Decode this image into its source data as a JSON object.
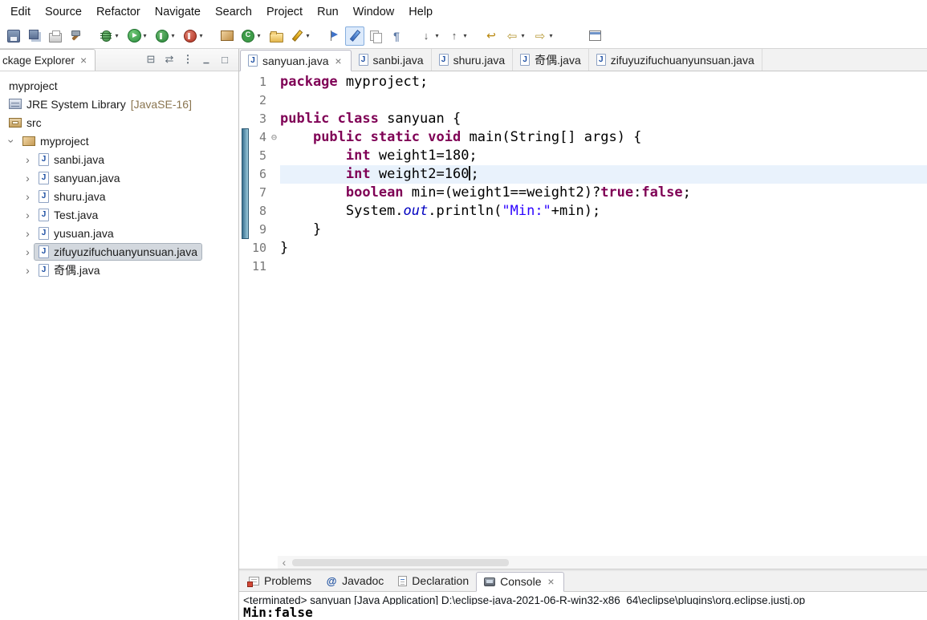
{
  "menu_bar": {
    "items": [
      "Edit",
      "Source",
      "Refactor",
      "Navigate",
      "Search",
      "Project",
      "Run",
      "Window",
      "Help"
    ]
  },
  "toolbar": {
    "icons": [
      {
        "name": "save-icon",
        "kind": "save"
      },
      {
        "name": "save-all-icon",
        "kind": "saveall"
      },
      {
        "name": "print-icon",
        "kind": "print"
      },
      {
        "name": "build-all-icon",
        "kind": "build"
      },
      {
        "name": "debug-icon",
        "kind": "debug",
        "dropdown": true,
        "group_start": true
      },
      {
        "name": "run-icon",
        "kind": "run",
        "dropdown": true
      },
      {
        "name": "coverage-icon",
        "kind": "coverage",
        "dropdown": true
      },
      {
        "name": "profile-icon",
        "kind": "profile",
        "dropdown": true
      },
      {
        "name": "new-java-project-icon",
        "kind": "package",
        "group_start": true
      },
      {
        "name": "new-class-icon",
        "kind": "class",
        "dropdown": true
      },
      {
        "name": "open-folder-icon",
        "kind": "folder"
      },
      {
        "name": "new-wizard-icon",
        "kind": "pencil",
        "dropdown": true
      },
      {
        "name": "search-icon",
        "kind": "flag",
        "group_start": true
      },
      {
        "name": "toggle-mark-occurrences-icon",
        "kind": "marker",
        "pressed": true
      },
      {
        "name": "compare-icon",
        "kind": "docs"
      },
      {
        "name": "show-whitespace-icon",
        "kind": "para"
      },
      {
        "name": "next-annotation-icon",
        "kind": "down",
        "dropdown": true,
        "group_start": true
      },
      {
        "name": "previous-annotation-icon",
        "kind": "up",
        "dropdown": true
      },
      {
        "name": "last-edit-location-icon",
        "kind": "lastedit",
        "group_start": true
      },
      {
        "name": "back-icon",
        "kind": "back",
        "dropdown": true
      },
      {
        "name": "forward-icon",
        "kind": "fwd",
        "dropdown": true
      },
      {
        "name": "restore-editor-icon",
        "kind": "window",
        "far": true
      }
    ]
  },
  "package_explorer": {
    "title": "ckage Explorer",
    "view_toolbar": [
      {
        "name": "collapse-all-icon",
        "kind": "collapse"
      },
      {
        "name": "link-with-editor-icon",
        "kind": "link"
      },
      {
        "name": "view-menu-icon",
        "kind": "menu"
      },
      {
        "name": "minimize-icon",
        "kind": "min"
      },
      {
        "name": "maximize-icon",
        "kind": "max"
      }
    ],
    "tree": [
      {
        "label": "myproject",
        "icon": "",
        "depth": 0
      },
      {
        "label": "JRE System Library",
        "suffix": " [JavaSE-16]",
        "icon": "library",
        "depth": 0
      },
      {
        "label": "src",
        "icon": "src-folder",
        "depth": 0
      },
      {
        "label": "myproject",
        "icon": "package",
        "depth": 0,
        "chevron": "expanded"
      },
      {
        "label": "sanbi.java",
        "icon": "java-file",
        "depth": 1,
        "chevron": "collapsed"
      },
      {
        "label": "sanyuan.java",
        "icon": "java-file",
        "depth": 1,
        "chevron": "collapsed"
      },
      {
        "label": "shuru.java",
        "icon": "java-file",
        "depth": 1,
        "chevron": "collapsed"
      },
      {
        "label": "Test.java",
        "icon": "java-file",
        "depth": 1,
        "chevron": "collapsed"
      },
      {
        "label": "yusuan.java",
        "icon": "java-file",
        "depth": 1,
        "chevron": "collapsed"
      },
      {
        "label": "zifuyuzifuchuanyunsuan.java",
        "icon": "java-file",
        "depth": 1,
        "chevron": "collapsed",
        "selected": true
      },
      {
        "label": "奇偶.java",
        "icon": "java-file",
        "depth": 1,
        "chevron": "collapsed"
      }
    ]
  },
  "editor": {
    "tabs": [
      {
        "label": "sanyuan.java",
        "active": true,
        "closable": true
      },
      {
        "label": "sanbi.java"
      },
      {
        "label": "shuru.java"
      },
      {
        "label": "奇偶.java"
      },
      {
        "label": "zifuyuzifuchuanyunsuan.java"
      }
    ],
    "code": {
      "range_indicator": {
        "from": 4,
        "to": 9
      },
      "lines": [
        {
          "num": 1,
          "tokens": [
            [
              "kw",
              "package"
            ],
            [
              "pl",
              " myproject;"
            ]
          ]
        },
        {
          "num": 2,
          "tokens": []
        },
        {
          "num": 3,
          "tokens": [
            [
              "kw",
              "public"
            ],
            [
              "pl",
              " "
            ],
            [
              "kw",
              "class"
            ],
            [
              "pl",
              " sanyuan {"
            ]
          ]
        },
        {
          "num": 4,
          "fold": true,
          "tokens": [
            [
              "pl",
              "    "
            ],
            [
              "kw",
              "public"
            ],
            [
              "pl",
              " "
            ],
            [
              "kw",
              "static"
            ],
            [
              "pl",
              " "
            ],
            [
              "kw",
              "void"
            ],
            [
              "pl",
              " main(String[] args) {"
            ]
          ]
        },
        {
          "num": 5,
          "tokens": [
            [
              "pl",
              "        "
            ],
            [
              "kw",
              "int"
            ],
            [
              "pl",
              " weight1=180;"
            ]
          ]
        },
        {
          "num": 6,
          "current": true,
          "tokens": [
            [
              "pl",
              "        "
            ],
            [
              "kw",
              "int"
            ],
            [
              "pl",
              " weight2=160"
            ],
            [
              "cursor",
              ""
            ],
            [
              "pl",
              ";"
            ]
          ]
        },
        {
          "num": 7,
          "tokens": [
            [
              "pl",
              "        "
            ],
            [
              "kw",
              "boolean"
            ],
            [
              "pl",
              " min=(weight1==weight2)?"
            ],
            [
              "kw",
              "true"
            ],
            [
              "pl",
              ":"
            ],
            [
              "kw",
              "false"
            ],
            [
              "pl",
              ";"
            ]
          ]
        },
        {
          "num": 8,
          "tokens": [
            [
              "pl",
              "        System."
            ],
            [
              "field",
              "out"
            ],
            [
              "pl",
              ".println("
            ],
            [
              "str",
              "\"Min:\""
            ],
            [
              "pl",
              "+min);"
            ]
          ]
        },
        {
          "num": 9,
          "tokens": [
            [
              "pl",
              "    }"
            ]
          ]
        },
        {
          "num": 10,
          "tokens": [
            [
              "pl",
              "}"
            ]
          ]
        },
        {
          "num": 11,
          "tokens": []
        }
      ]
    }
  },
  "console": {
    "tabs": [
      {
        "label": "Problems",
        "icon": "problems"
      },
      {
        "label": "Javadoc",
        "icon": "javadoc"
      },
      {
        "label": "Declaration",
        "icon": "declaration"
      },
      {
        "label": "Console",
        "icon": "console",
        "active": true,
        "closable": true
      }
    ],
    "status_line": "<terminated> sanyuan [Java Application] D:\\eclipse-java-2021-06-R-win32-x86_64\\eclipse\\plugins\\org.eclipse.justj.op",
    "output": "Min:false"
  }
}
